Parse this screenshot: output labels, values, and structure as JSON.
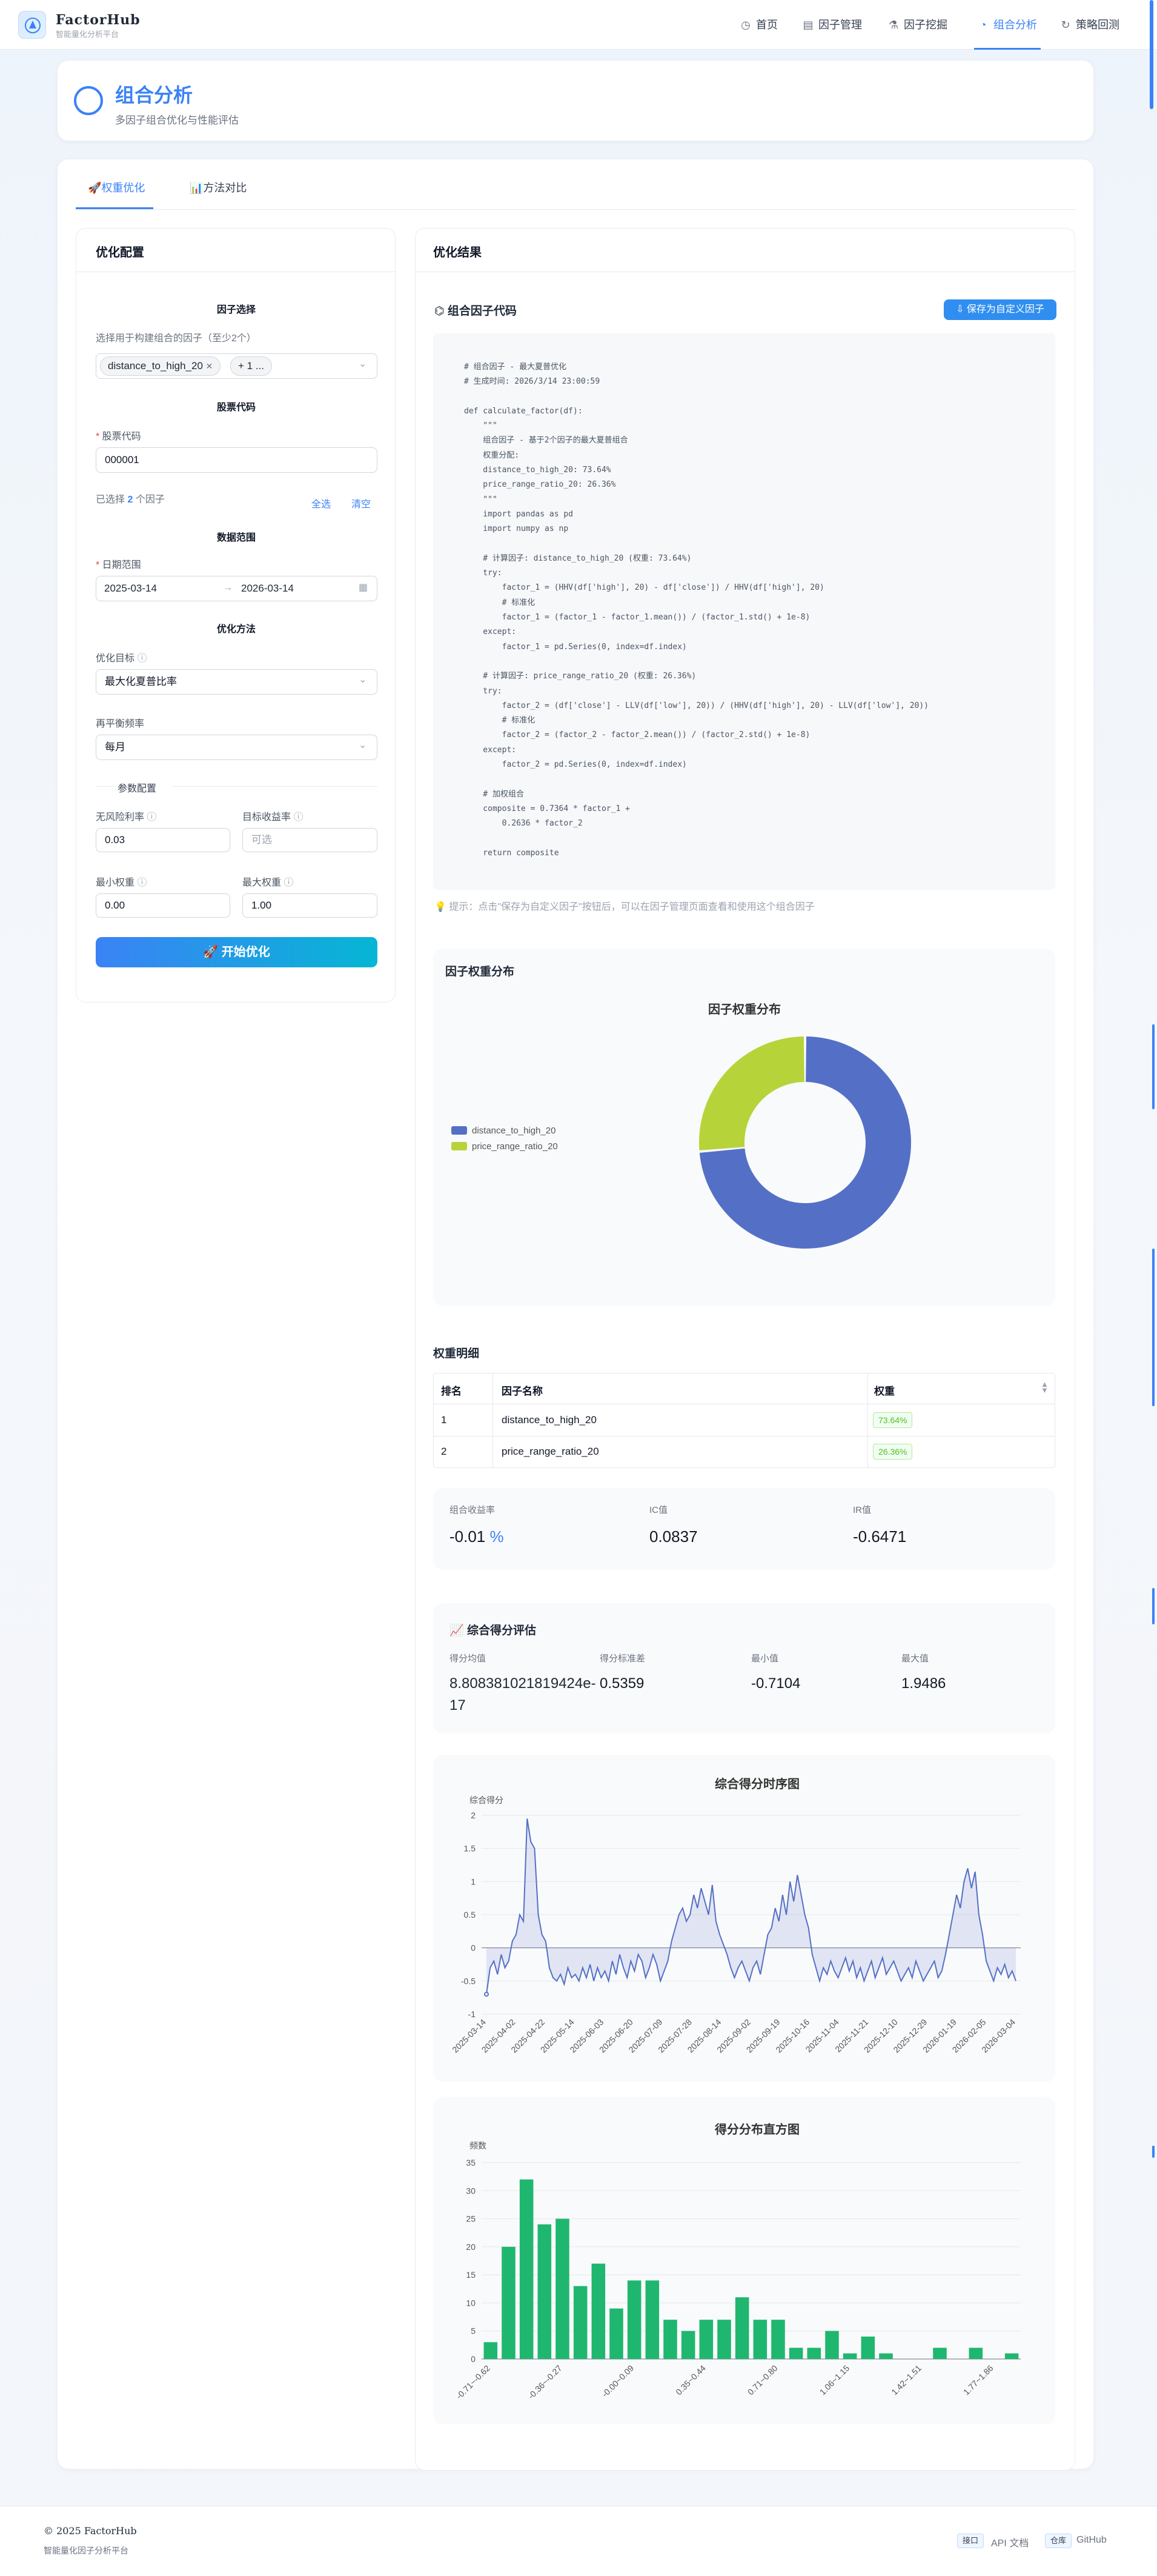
{
  "nav": {
    "brand": "FactorHub",
    "brand_sub": "智能量化分析平台",
    "items": [
      {
        "label": "首页",
        "icon": "dashboard-icon"
      },
      {
        "label": "因子管理",
        "icon": "document-icon"
      },
      {
        "label": "因子挖掘",
        "icon": "flask-icon"
      },
      {
        "label": "组合分析",
        "icon": "pie-chart-icon",
        "active": true
      },
      {
        "label": "策略回测",
        "icon": "refresh-icon"
      }
    ]
  },
  "header": {
    "title": "组合分析",
    "subtitle": "多因子组合优化与性能评估"
  },
  "tabs": [
    {
      "label": "权重优化",
      "active": true
    },
    {
      "label": "方法对比"
    }
  ],
  "config": {
    "title": "优化配置",
    "factor_section": "因子选择",
    "factor_hint": "选择用于构建组合的因子（至少2个）",
    "factor_chip": "distance_to_high_20",
    "factor_more": "+ 1 ...",
    "stock_section": "股票代码",
    "stock_label": "股票代码",
    "stock_value": "000001",
    "selected_prefix": "已选择",
    "selected_count": "2",
    "selected_suffix": "个因子",
    "select_all": "全选",
    "clear": "清空",
    "date_section": "数据范围",
    "date_label": "日期范围",
    "date_start": "2025-03-14",
    "date_arrow": "→",
    "date_end": "2026-03-14",
    "method_section": "优化方法",
    "target_label": "优化目标",
    "target_value": "最大化夏普比率",
    "rebalance_label": "再平衡频率",
    "rebalance_value": "每月",
    "param_section": "参数配置",
    "rf_label": "无风险利率",
    "rf_value": "0.03",
    "target_return_label": "目标收益率",
    "target_return_placeholder": "可选",
    "min_w_label": "最小权重",
    "min_w_value": "0.00",
    "max_w_label": "最大权重",
    "max_w_value": "1.00",
    "start_button": "开始优化"
  },
  "results": {
    "title": "优化结果",
    "code_title": "组合因子代码",
    "save_button": "保存为自定义因子",
    "code": "# 组合因子 - 最大夏普优化\n# 生成时间: 2026/3/14 23:00:59\n\ndef calculate_factor(df):\n    \"\"\"\n    组合因子 - 基于2个因子的最大夏普组合\n    权重分配:\n    distance_to_high_20: 73.64%\n    price_range_ratio_20: 26.36%\n    \"\"\"\n    import pandas as pd\n    import numpy as np\n\n    # 计算因子: distance_to_high_20 (权重: 73.64%)\n    try:\n        factor_1 = (HHV(df['high'], 20) - df['close']) / HHV(df['high'], 20)\n        # 标准化\n        factor_1 = (factor_1 - factor_1.mean()) / (factor_1.std() + 1e-8)\n    except:\n        factor_1 = pd.Series(0, index=df.index)\n\n    # 计算因子: price_range_ratio_20 (权重: 26.36%)\n    try:\n        factor_2 = (df['close'] - LLV(df['low'], 20)) / (HHV(df['high'], 20) - LLV(df['low'], 20))\n        # 标准化\n        factor_2 = (factor_2 - factor_2.mean()) / (factor_2.std() + 1e-8)\n    except:\n        factor_2 = pd.Series(0, index=df.index)\n\n    # 加权组合\n    composite = 0.7364 * factor_1 +\n        0.2636 * factor_2\n\n    return composite",
    "tip": "提示：点击\"保存为自定义因子\"按钮后，可以在因子管理页面查看和使用这个组合因子",
    "weight_section": "因子权重分布",
    "weight_detail_title": "权重明细",
    "table_headers": [
      "排名",
      "因子名称",
      "权重"
    ],
    "table_rows": [
      {
        "rank": "1",
        "name": "distance_to_high_20",
        "weight": "73.64%"
      },
      {
        "rank": "2",
        "name": "price_range_ratio_20",
        "weight": "26.36%"
      }
    ],
    "metrics": [
      {
        "label": "组合收益率",
        "value": "-0.01",
        "unit": "%"
      },
      {
        "label": "IC值",
        "value": "0.0837"
      },
      {
        "label": "IR值",
        "value": "-0.6471"
      }
    ],
    "score_title": "综合得分评估",
    "score_stats": [
      {
        "label": "得分均值",
        "value": "8.808381021819424e-17"
      },
      {
        "label": "得分标准差",
        "value": "0.5359"
      },
      {
        "label": "最小值",
        "value": "-0.7104"
      },
      {
        "label": "最大值",
        "value": "1.9486"
      }
    ]
  },
  "chart_data": [
    {
      "type": "pie",
      "title": "因子权重分布",
      "labels": [
        "distance_to_high_20",
        "price_range_ratio_20"
      ],
      "values": [
        73.64,
        26.36
      ],
      "colors": [
        "#5470c6",
        "#b7d33a"
      ],
      "legend": "left"
    },
    {
      "type": "line",
      "title": "综合得分时序图",
      "ylabel": "综合得分",
      "ylim": [
        -1,
        2
      ],
      "yticks": [
        -1,
        -0.5,
        0,
        0.5,
        1,
        1.5,
        2
      ],
      "xticks": [
        "2025-03-14",
        "2025-04-02",
        "2025-04-22",
        "2025-05-14",
        "2025-06-03",
        "2025-06-20",
        "2025-07-09",
        "2025-07-28",
        "2025-08-14",
        "2025-09-02",
        "2025-09-19",
        "2025-10-16",
        "2025-11-04",
        "2025-11-21",
        "2025-12-10",
        "2025-12-29",
        "2026-01-19",
        "2026-02-05",
        "2026-03-04"
      ],
      "color": "#5470c6",
      "values": [
        -0.7,
        -0.3,
        -0.2,
        -0.4,
        -0.1,
        -0.3,
        -0.2,
        0.1,
        0.2,
        0.5,
        0.4,
        1.95,
        1.6,
        1.5,
        0.5,
        0.2,
        0.1,
        -0.3,
        -0.45,
        -0.5,
        -0.4,
        -0.55,
        -0.3,
        -0.45,
        -0.4,
        -0.5,
        -0.3,
        -0.45,
        -0.25,
        -0.5,
        -0.3,
        -0.45,
        -0.35,
        -0.5,
        -0.2,
        -0.4,
        -0.1,
        -0.3,
        -0.45,
        -0.2,
        -0.35,
        -0.1,
        -0.2,
        -0.45,
        -0.3,
        -0.1,
        -0.25,
        -0.5,
        -0.35,
        -0.2,
        0.1,
        0.3,
        0.5,
        0.6,
        0.4,
        0.5,
        0.8,
        0.6,
        0.9,
        0.7,
        0.5,
        0.95,
        0.4,
        0.2,
        0.05,
        -0.1,
        -0.3,
        -0.45,
        -0.3,
        -0.2,
        -0.35,
        -0.5,
        -0.3,
        -0.2,
        -0.4,
        -0.1,
        0.2,
        0.3,
        0.6,
        0.4,
        0.8,
        0.5,
        1.0,
        0.7,
        1.1,
        0.8,
        0.5,
        0.3,
        -0.1,
        -0.3,
        -0.5,
        -0.3,
        -0.4,
        -0.2,
        -0.35,
        -0.45,
        -0.3,
        -0.15,
        -0.35,
        -0.2,
        -0.45,
        -0.3,
        -0.5,
        -0.35,
        -0.2,
        -0.45,
        -0.3,
        -0.15,
        -0.4,
        -0.3,
        -0.2,
        -0.35,
        -0.5,
        -0.4,
        -0.3,
        -0.45,
        -0.2,
        -0.35,
        -0.5,
        -0.4,
        -0.3,
        -0.2,
        -0.45,
        -0.35,
        -0.1,
        0.2,
        0.5,
        0.8,
        0.6,
        1.0,
        1.2,
        0.9,
        1.15,
        0.5,
        0.2,
        -0.2,
        -0.35,
        -0.5,
        -0.3,
        -0.4,
        -0.25,
        -0.45,
        -0.35,
        -0.5
      ]
    },
    {
      "type": "bar",
      "title": "得分分布直方图",
      "ylabel": "频数",
      "ylim": [
        0,
        35
      ],
      "yticks": [
        0,
        5,
        10,
        15,
        20,
        25,
        30,
        35
      ],
      "tick_labels": [
        "-0.71~-0.62",
        "-0.36~-0.27",
        "-0.00~0.09",
        "0.35~0.44",
        "0.71~0.80",
        "1.06~1.15",
        "1.42~1.51",
        "1.77~1.86"
      ],
      "color": "#1fb76f",
      "values": [
        3,
        20,
        32,
        24,
        25,
        13,
        17,
        9,
        14,
        14,
        7,
        5,
        7,
        7,
        11,
        7,
        7,
        2,
        2,
        5,
        1,
        4,
        1,
        0,
        0,
        2,
        0,
        2,
        0,
        1
      ]
    }
  ],
  "footer": {
    "copyright": "© 2025 FactorHub",
    "sub": "智能量化因子分析平台",
    "api_tag": "接口",
    "api_label": "API 文档",
    "repo_tag": "仓库",
    "repo_label": "GitHub"
  }
}
